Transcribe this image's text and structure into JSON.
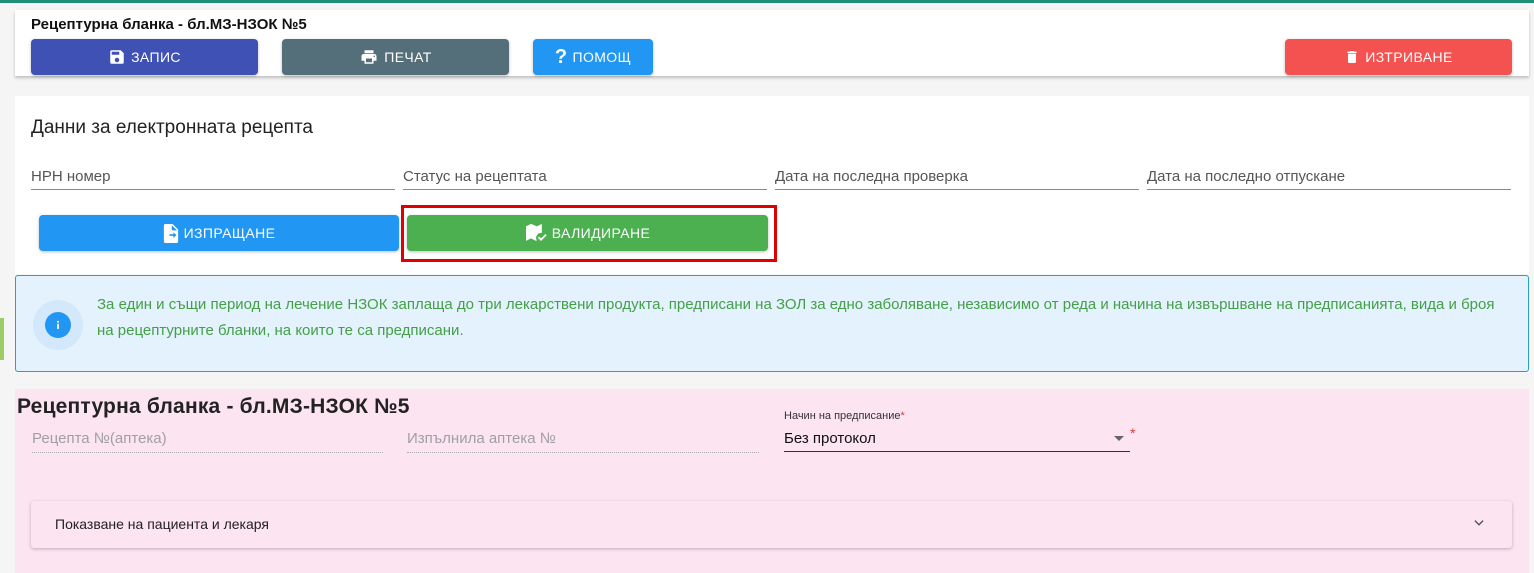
{
  "header": {
    "title": "Рецептурна бланка - бл.МЗ-НЗОК №5",
    "save_label": "ЗАПИС",
    "print_label": "ПЕЧАТ",
    "help_label": "ПОМОЩ",
    "delete_label": "ИЗТРИВАНЕ"
  },
  "eprescription": {
    "title": "Данни за електронната рецепта",
    "fields": {
      "nrn": "НРН номер",
      "status": "Статус на рецептата",
      "last_check": "Дата на последна проверка",
      "last_dispense": "Дата на последно отпускане"
    },
    "send_label": "ИЗПРАЩАНЕ",
    "validate_label": "ВАЛИДИРАНЕ"
  },
  "info": {
    "text": "За един и същи период на лечение НЗОК заплаща до три лекарствени продукта, предписани на ЗОЛ за едно заболяване, независимо от реда и начина на извършване на предписанията, вида и броя на рецептурните бланки, на които те са предписани."
  },
  "form": {
    "title": "Рецептурна бланка - бл.МЗ-НЗОК №5",
    "prescription_no_placeholder": "Рецепта №(аптека)",
    "pharmacy_placeholder": "Изпълнила аптека №",
    "method_label": "Начин на предписание",
    "method_value": "Без протокол",
    "required_mark": "*",
    "expander_label": "Показване на пациента и лекаря"
  },
  "colors": {
    "save": "#3f51b5",
    "print": "#546e7a",
    "help": "#2196f3",
    "delete": "#f45151",
    "validate": "#4caf50",
    "highlight": "#e00000",
    "info_text": "#43a047",
    "form_bg": "#fce4f1"
  },
  "icons": {
    "save": "floppy-disk-icon",
    "print": "printer-icon",
    "help": "question-mark-icon",
    "delete": "trash-icon",
    "send": "file-send-icon",
    "validate": "map-check-icon",
    "info": "info-icon",
    "dropdown": "caret-down-icon",
    "expand": "chevron-down-icon"
  }
}
